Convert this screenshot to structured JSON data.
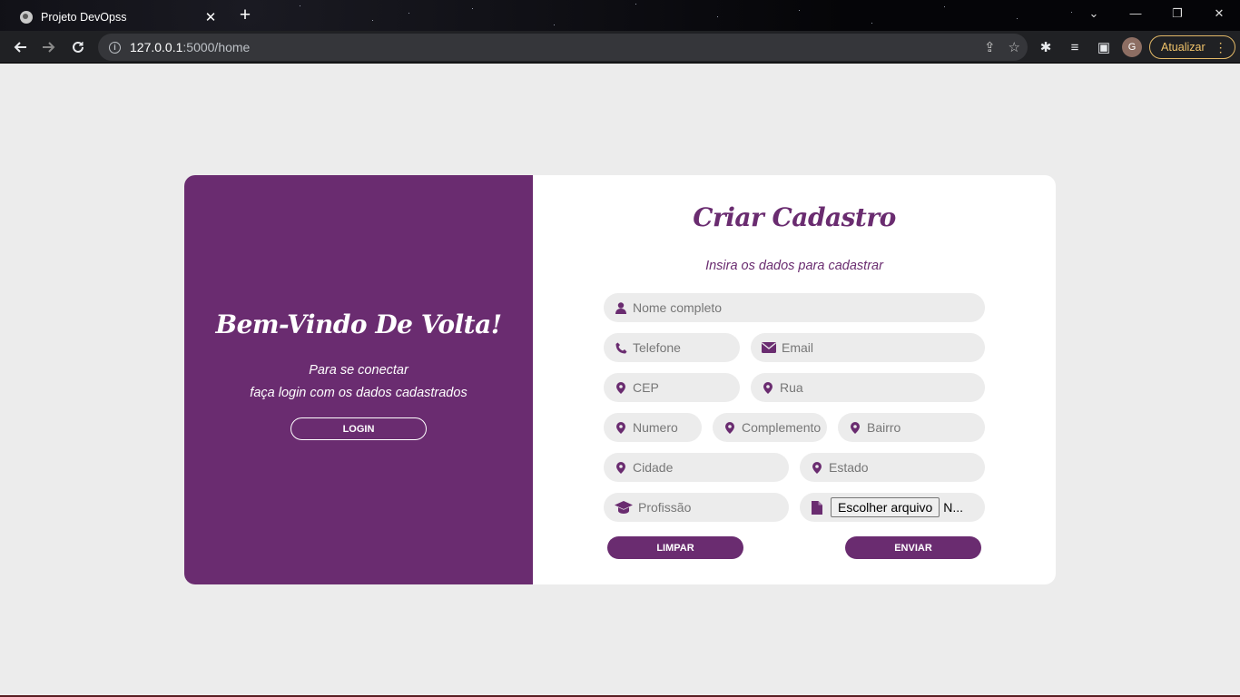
{
  "browser": {
    "tab_title": "Projeto DevOpss",
    "tab_close": "✕",
    "new_tab": "+",
    "url_host": "127.0.0.1",
    "url_rest": ":5000/home",
    "update_label": "Atualizar",
    "avatar_initial": "G"
  },
  "left": {
    "title": "Bem-Vindo De Volta!",
    "subtitle_line1": "Para se conectar",
    "subtitle_line2": "faça login com os dados cadastrados",
    "login_label": "LOGIN"
  },
  "form": {
    "title": "Criar Cadastro",
    "subtitle": "Insira os dados para cadastrar",
    "placeholders": {
      "nome": "Nome completo",
      "telefone": "Telefone",
      "email": "Email",
      "cep": "CEP",
      "rua": "Rua",
      "numero": "Numero",
      "complemento": "Complemento",
      "bairro": "Bairro",
      "cidade": "Cidade",
      "estado": "Estado",
      "profissao": "Profissão"
    },
    "file_button": "Escolher arquivo",
    "file_status": "N...",
    "clear_label": "LIMPAR",
    "submit_label": "ENVIAR"
  },
  "colors": {
    "accent": "#6a2c70",
    "field_bg": "#ececec",
    "page_bg": "#ececec"
  }
}
